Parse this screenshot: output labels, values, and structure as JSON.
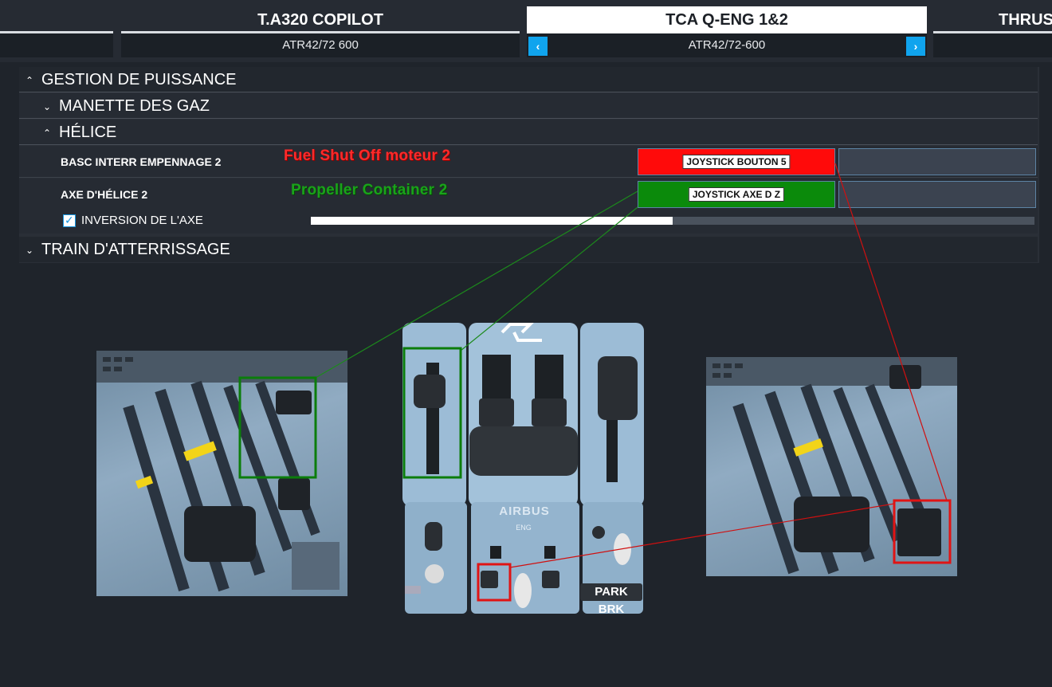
{
  "tabs": [
    {
      "title": "",
      "subtitle": ""
    },
    {
      "title": "T.A320 COPILOT",
      "subtitle": "ATR42/72 600"
    },
    {
      "title": "TCA Q-ENG 1&2",
      "subtitle": "ATR42/72-600"
    },
    {
      "title": "THRUS",
      "subtitle": ""
    }
  ],
  "nav": {
    "prev_icon": "‹",
    "next_icon": "›"
  },
  "categories": {
    "power": "GESTION DE PUISSANCE",
    "throttle": "MANETTE DES GAZ",
    "propeller": "HÉLICE",
    "landing_gear": "TRAIN D'ATTERRISSAGE"
  },
  "bindings": [
    {
      "label": "BASC INTERR EMPENNAGE 2",
      "annotation": "Fuel Shut Off moteur 2",
      "primary": "JOYSTICK BOUTON 5",
      "color": "#ff0a0a"
    },
    {
      "label": "AXE D'HÉLICE 2",
      "annotation": "Propeller Container 2",
      "primary": "JOYSTICK AXE D Z",
      "color": "#0b8a0b"
    }
  ],
  "inversion": {
    "label": "INVERSION DE L'AXE",
    "checked": true,
    "axis_level": 0.5
  },
  "hardware": {
    "brand": "AIRBUS",
    "eng": "ENG",
    "park_brake": "PARK BRK"
  },
  "colors": {
    "accent": "#10a4ee",
    "highlight_red": "#ff0a0a",
    "highlight_green": "#0b8a0b"
  }
}
